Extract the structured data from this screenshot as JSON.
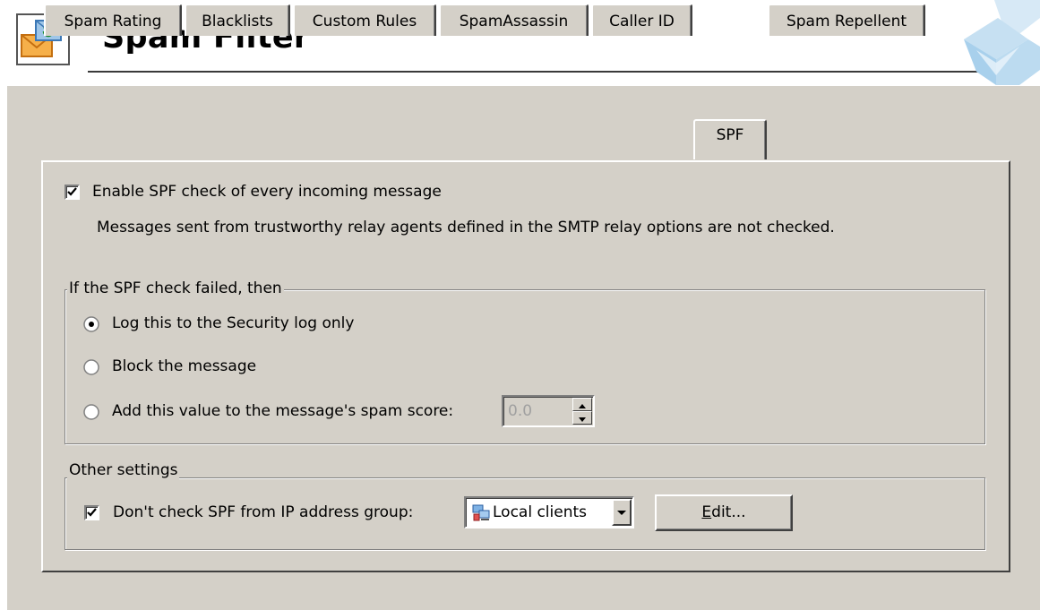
{
  "header": {
    "title": "Spam Filter"
  },
  "tabs": [
    {
      "label": "Spam Rating",
      "active": false
    },
    {
      "label": "Blacklists",
      "active": false
    },
    {
      "label": "Custom Rules",
      "active": false
    },
    {
      "label": "SpamAssassin",
      "active": false
    },
    {
      "label": "Caller ID",
      "active": false
    },
    {
      "label": "SPF",
      "active": true
    },
    {
      "label": "Spam Repellent",
      "active": false
    }
  ],
  "spf": {
    "enable_label": "Enable SPF check of every incoming message",
    "enable_checked": true,
    "note": "Messages sent from trustworthy relay agents defined in the SMTP relay options are not checked."
  },
  "failed_group": {
    "title": "If the SPF check failed, then",
    "options": [
      {
        "label": "Log this to the Security log only",
        "selected": true
      },
      {
        "label": "Block the message",
        "selected": false
      },
      {
        "label": "Add this value to the message's spam score:",
        "selected": false
      }
    ],
    "score_value": "0.0"
  },
  "other_group": {
    "title": "Other settings",
    "dont_check_label": "Don't check SPF from IP address group:",
    "dont_check_checked": true,
    "ip_group_selected": "Local clients",
    "edit_label": "Edit..."
  },
  "icons": {
    "app": "envelope-refresh-icon",
    "brand": "kerio-logo",
    "combo": "computers-group-icon"
  }
}
